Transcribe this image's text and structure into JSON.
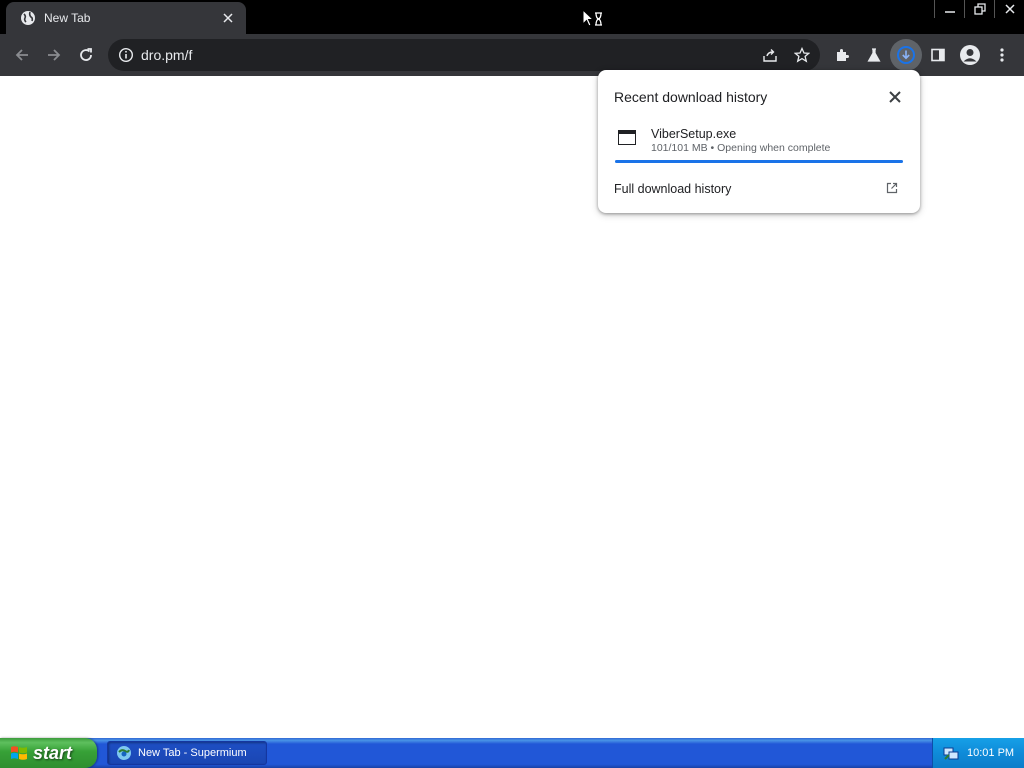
{
  "browser": {
    "tab": {
      "title": "New Tab"
    },
    "omnibox": {
      "url": "dro.pm/f"
    },
    "toolbar_icons": [
      "back-icon",
      "forward-icon",
      "reload-icon",
      "info-icon",
      "share-icon",
      "bookmark-star-icon",
      "extensions-icon",
      "labs-flask-icon",
      "download-icon",
      "side-panel-icon",
      "profile-icon",
      "more-menu-icon"
    ]
  },
  "download_bubble": {
    "title": "Recent download history",
    "item": {
      "file_name": "ViberSetup.exe",
      "status": "101/101 MB • Opening when complete",
      "progress_fraction": 1.0
    },
    "full_history_label": "Full download history",
    "accent_color": "#1a73e8"
  },
  "taskbar": {
    "start_label": "start",
    "task_label": "New Tab - Supermium",
    "clock": "10:01 PM"
  }
}
